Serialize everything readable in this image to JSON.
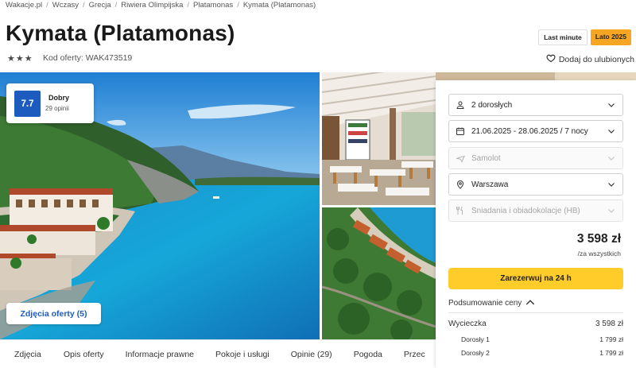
{
  "breadcrumb": [
    "Wakacje.pl",
    "Wczasy",
    "Grecja",
    "Riwiera Olimpijska",
    "Platamonas",
    "Kymata (Platamonas)"
  ],
  "breadcrumb_separator": "/",
  "hotel": {
    "title": "Kymata (Platamonas)",
    "stars": 3,
    "offer_code": "Kod oferty: WAK473519"
  },
  "badges": {
    "last_minute": "Last minute",
    "season": "Lato 2025"
  },
  "favorite_label": "Dodaj do ulubionych",
  "rating": {
    "score": "7.7",
    "label": "Dobry",
    "count": "29 opinii"
  },
  "photos_button": "Zdjęcia oferty (5)",
  "booking": {
    "guests": "2 dorosłych",
    "dates": "21.06.2025 - 28.06.2025 / 7 nocy",
    "transport": "Samolot",
    "departure": "Warszawa",
    "board": "Śniadania i obiadokolacje (HB)",
    "price": "3 598 zł",
    "price_note": "/za wszystkich",
    "book_label": "Zarezerwuj na 24 h",
    "summary_label": "Podsumowanie ceny"
  },
  "summary": {
    "trip_label": "Wycieczka",
    "trip_value": "3 598 zł",
    "adult1_label": "Dorosły 1",
    "adult1_value": "1 799 zł",
    "adult2_label": "Dorosły 2",
    "adult2_value": "1 799 zł"
  },
  "tabs": [
    "Zdjęcia",
    "Opis oferty",
    "Informacje prawne",
    "Pokoje i usługi",
    "Opinie (29)",
    "Pogoda",
    "Przec"
  ],
  "colors": {
    "brand_blue": "#1d5bbf",
    "cta_yellow": "#ffcc29",
    "badge_orange": "#f6a623"
  },
  "icons": {
    "guests": "person-icon",
    "dates": "calendar-icon",
    "transport": "plane-icon",
    "departure": "location-pin-icon",
    "board": "cutlery-icon",
    "favorite": "heart-icon"
  }
}
